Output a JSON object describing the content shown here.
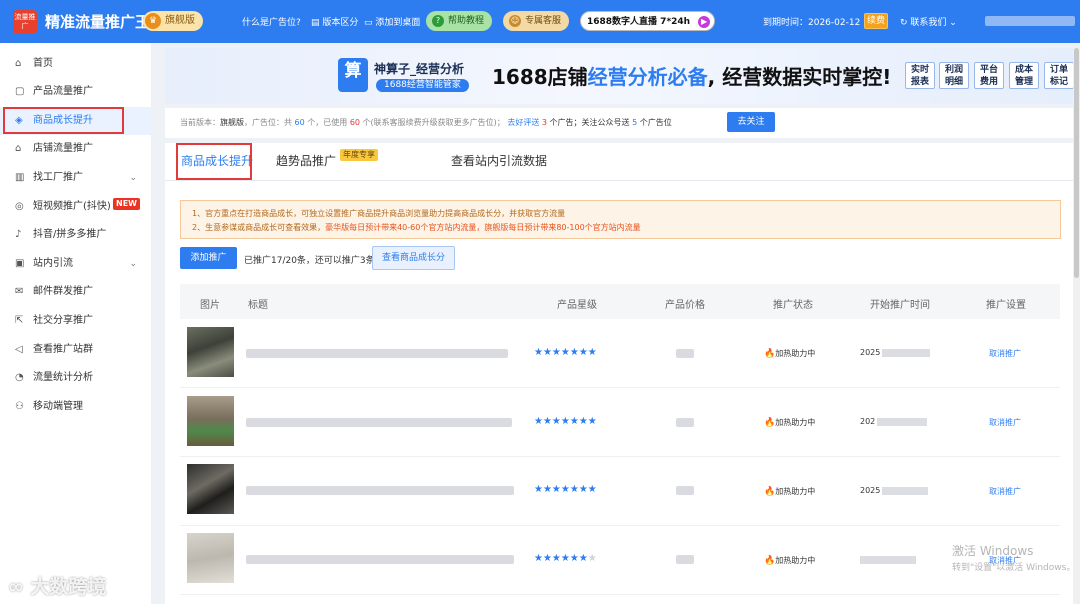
{
  "topbar": {
    "logo_text": "流量推广",
    "app_title": "精准流量推广王",
    "edition_badge": "旗舰版",
    "links": [
      "什么是广告位?",
      "版本区分",
      "添加到桌面"
    ],
    "help_btn": "帮助教程",
    "service_btn": "专属客服",
    "live_btn": "1688数字人直播 7*24h",
    "expiry_label": "到期时间：2026-02-12",
    "renew_btn": "续费",
    "contact_btn": "联系我们"
  },
  "sidebar": {
    "items": [
      {
        "label": "首页",
        "icon": "home-icon"
      },
      {
        "label": "产品流量推广",
        "icon": "box-icon"
      },
      {
        "label": "商品成长提升",
        "icon": "bag-icon"
      },
      {
        "label": "店铺流量推广",
        "icon": "store-icon"
      },
      {
        "label": "找工厂推广",
        "icon": "factory-icon"
      },
      {
        "label": "短视频推广(抖快)",
        "icon": "video-icon",
        "badge": "NEW"
      },
      {
        "label": "抖音/拼多多推广",
        "icon": "tiktok-icon"
      },
      {
        "label": "站内引流",
        "icon": "chart-icon"
      },
      {
        "label": "邮件群发推广",
        "icon": "mail-icon"
      },
      {
        "label": "社交分享推广",
        "icon": "share-icon"
      },
      {
        "label": "查看推广站群",
        "icon": "megaphone-icon"
      },
      {
        "label": "流量统计分析",
        "icon": "stats-icon"
      },
      {
        "label": "移动端管理",
        "icon": "mobile-icon"
      }
    ]
  },
  "banner": {
    "app_icon_char": "算",
    "app_name": "神算子_经营分析",
    "app_sub": "1688经营智能管家",
    "headline_a": "1688店铺",
    "headline_b": "经营分析必备",
    "headline_c": ", 经营数据实时掌控!",
    "tags": [
      "实时\n报表",
      "利润\n明细",
      "平台\n费用",
      "成本\n管理",
      "订单\n标记"
    ]
  },
  "info": {
    "a": "当前版本：",
    "b": "旗舰版",
    "c": "，广告位：共",
    "d": "60",
    "e": "个，已使用",
    "f": "60",
    "g": "个(联系客服续费升级获取更多广告位)；",
    "h": "去好评送",
    "i": "3",
    "j": "个广告；关注公众号送",
    "k": "5",
    "l": "个广告位",
    "follow_btn": "去关注"
  },
  "tabs": {
    "growth": "商品成长提升",
    "trend": "趋势品推广",
    "trend_badge": "年度专享",
    "traffic": "查看站内引流数据"
  },
  "notice": {
    "line1": "1、官方重点在打造商品成长，可独立设置推广商品提升商品浏览量助力提高商品成长分，并获取官方流量",
    "line2a": "2、生意参谋或商品成长可查看效果，",
    "line2b": "豪华版每日预计带来40-60个官方站内流量，旗舰版每日预计带来80-100个官方站内流量"
  },
  "actions": {
    "add_btn": "添加推广",
    "promo_text": "已推广17/20条，还可以推广3条",
    "view_btn": "查看商品成长分"
  },
  "table": {
    "headers": [
      "图片",
      "标题",
      "产品星级",
      "产品价格",
      "推广状态",
      "开始推广时间",
      "推广设置"
    ],
    "rows": [
      {
        "stars": 7,
        "stars_total": 7,
        "status": "加热助力中",
        "date": "2025",
        "action": "取消推广"
      },
      {
        "stars": 7,
        "stars_total": 7,
        "status": "加热助力中",
        "date": "202",
        "action": "取消推广"
      },
      {
        "stars": 7,
        "stars_total": 7,
        "status": "加热助力中",
        "date": "2025",
        "action": "取消推广"
      },
      {
        "stars": 6,
        "stars_total": 7,
        "status": "加热助力中",
        "date": "",
        "action": "取消推广"
      }
    ]
  },
  "watermark": {
    "line1": "激活 Windows",
    "line2": "转到\"设置\"以激活 Windows。",
    "brand": "大数跨境"
  },
  "colors": {
    "primary": "#2d7df0",
    "topbar": "#2d7df0",
    "danger": "#e03a3a",
    "notice_bg": "#fdf3e7"
  }
}
